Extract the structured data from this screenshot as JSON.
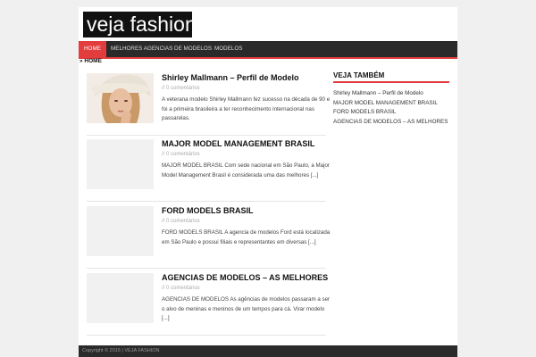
{
  "site": {
    "logo_text": "veja fashion"
  },
  "nav": {
    "items": [
      {
        "label": "HOME"
      },
      {
        "label": "MELHORES AGENCIAS DE MODELOS"
      },
      {
        "label": "MODELOS"
      }
    ]
  },
  "breadcrumb": {
    "text": "» HOME"
  },
  "posts": [
    {
      "title": "Shirley Mallmann – Perfil de Modelo",
      "meta": "// 0 comentários",
      "excerpt": "A veterana modelo Shirley Mallmann fez sucesso na década de 90 e foi a primeira brasileira a ter reconhecimento internacional nas passarelas."
    },
    {
      "title": "MAJOR MODEL MANAGEMENT BRASIL",
      "meta": "// 0 comentários",
      "excerpt": "MAJOR MODEL BRASIL Com sede nacional em São Paulo, a Major Model Management Brasil é considerada uma das melhores [...]"
    },
    {
      "title": "FORD MODELS BRASIL",
      "meta": "// 0 comentários",
      "excerpt": "FORD MODELS BRASIL A agencia de modelos Ford está localizada em São Paulo e possui filiais e representantes em diversas [...]"
    },
    {
      "title": "AGENCIAS DE MODELOS – AS MELHORES",
      "meta": "// 0 comentários",
      "excerpt": "AGENCIAS DE MODELOS As agências de modelos passaram a ser o alvo de meninas e meninos de um tempos para cá. Virar modelo [...]"
    }
  ],
  "sidebar": {
    "title": "VEJA TAMBÉM",
    "links": [
      {
        "label": "Shirley Mallmann – Perfil de Modelo"
      },
      {
        "label": "MAJOR MODEL MANAGEMENT BRASIL"
      },
      {
        "label": "FORD MODELS BRASIL"
      },
      {
        "label": "AGENCIAS DE MODELOS – AS MELHORES"
      }
    ]
  },
  "footer": {
    "text": "Copyright © 2015 | VEJA FASHION"
  },
  "colors": {
    "accent": "#e23c3c",
    "nav_bg": "#2a2a2a",
    "page_bg": "#f0f0f0"
  }
}
